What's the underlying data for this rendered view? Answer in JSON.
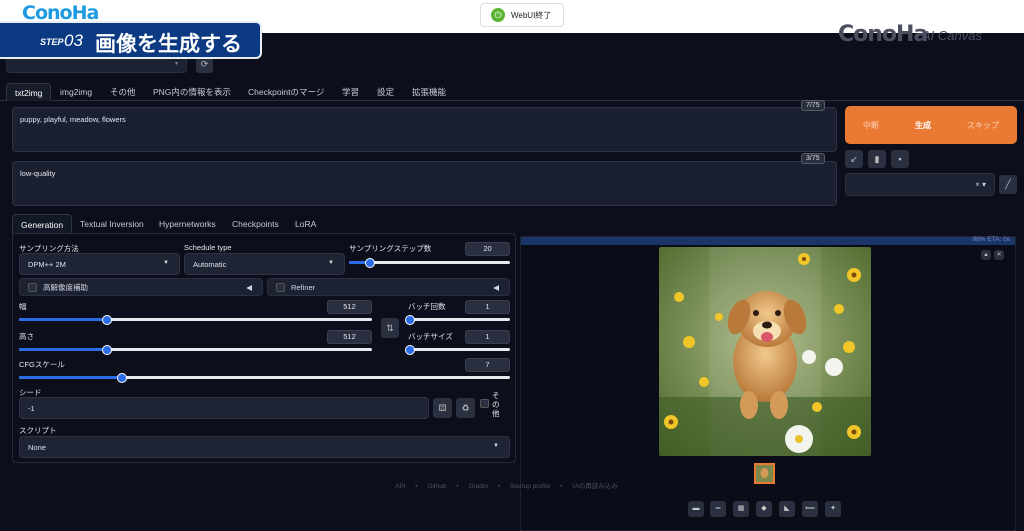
{
  "overlay": {
    "logo_text": "ConoHa",
    "step_label": "STEP",
    "step_number": "03",
    "step_title": "画像を生成する",
    "webui_button": "WebUI終了",
    "brand_text": "ConoHa",
    "brand_sub": "AI Canvas"
  },
  "top_tabs": [
    "txt2img",
    "img2img",
    "その他",
    "PNG内の情報を表示",
    "Checkpointのマージ",
    "学習",
    "設定",
    "拡張機能"
  ],
  "prompt": {
    "text": "puppy, playful, meadow, flowers",
    "counter": "7/75"
  },
  "negative_prompt": {
    "text": "low-quality",
    "counter": "3/75"
  },
  "generate": {
    "interrupt": "中断",
    "label": "生成",
    "skip": "スキップ"
  },
  "style_select": {
    "value": "× ▾"
  },
  "gen_tabs": [
    "Generation",
    "Textual Inversion",
    "Hypernetworks",
    "Checkpoints",
    "LoRA"
  ],
  "params": {
    "sampler_label": "サンプリング方法",
    "sampler_value": "DPM++ 2M",
    "schedule_label": "Schedule type",
    "schedule_value": "Automatic",
    "steps_label": "サンプリングステップ数",
    "steps_value": "20",
    "hires_label": "高解像度補助",
    "refiner_label": "Refiner",
    "width_label": "幅",
    "width_value": "512",
    "height_label": "高さ",
    "height_value": "512",
    "batch_count_label": "バッチ回数",
    "batch_count_value": "1",
    "batch_size_label": "バッチサイズ",
    "batch_size_value": "1",
    "cfg_label": "CFGスケール",
    "cfg_value": "7",
    "seed_label": "シード",
    "seed_value": "-1",
    "extra_label": "その他",
    "script_label": "スクリプト",
    "script_value": "None"
  },
  "sliders": {
    "steps": 0.13,
    "width": 0.25,
    "height": 0.25,
    "batch_count": 0.02,
    "batch_size": 0.02,
    "cfg": 0.21
  },
  "output": {
    "progress_text": "98% ETA: 0s"
  },
  "footer": {
    "api": "API",
    "github": "Github",
    "gradio": "Gradio",
    "startup": "Startup profile",
    "reload": "UIの再読み込み",
    "sep": "•"
  },
  "colors": {
    "accent": "#ea7a33",
    "slider": "#2c6ce6",
    "banner": "#0c3a82"
  }
}
